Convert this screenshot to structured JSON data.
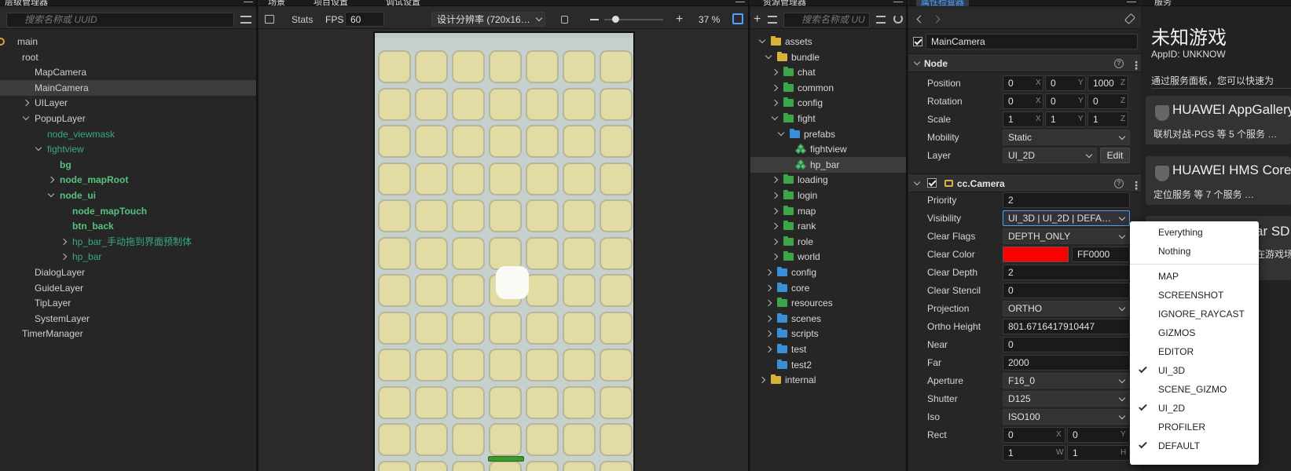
{
  "hierarchy": {
    "tab": "层级管理器",
    "search_placeholder": "搜索名称或 UUID",
    "nodes": [
      "main",
      "root",
      "MapCamera",
      "MainCamera",
      "UILayer",
      "PopupLayer",
      "node_viewmask",
      "fightview",
      "bg",
      "node_mapRoot",
      "node_ui",
      "node_mapTouch",
      "btn_back",
      "hp_bar_手动拖到界面预制体",
      "hp_bar",
      "DialogLayer",
      "GuideLayer",
      "TipLayer",
      "SystemLayer",
      "TimerManager"
    ]
  },
  "scene": {
    "tabs": [
      "场景",
      "项目设置",
      "调试设置"
    ],
    "stats_label": "Stats",
    "fps_label": "FPS",
    "fps_value": "60",
    "resolution": "设计分辨率 (720x16…",
    "zoom": "37 %"
  },
  "assets": {
    "tab": "资源管理器",
    "search_placeholder": "搜索名称或 UU",
    "items": [
      "assets",
      "bundle",
      "chat",
      "common",
      "config",
      "fight",
      "prefabs",
      "fightview",
      "hp_bar",
      "loading",
      "login",
      "map",
      "rank",
      "role",
      "world",
      "config",
      "core",
      "resources",
      "scenes",
      "scripts",
      "test",
      "test2",
      "internal"
    ]
  },
  "inspector": {
    "tab": "属性检查器",
    "node_name": "MainCamera",
    "node_section": "Node",
    "position_label": "Position",
    "position": [
      "0",
      "0",
      "1000"
    ],
    "rotation_label": "Rotation",
    "rotation": [
      "0",
      "0",
      "0"
    ],
    "scale_label": "Scale",
    "scale": [
      "1",
      "1",
      "1"
    ],
    "axes": [
      "X",
      "Y",
      "Z"
    ],
    "mobility_label": "Mobility",
    "mobility": "Static",
    "layer_label": "Layer",
    "layer": "UI_2D",
    "edit_label": "Edit",
    "camera_section": "cc.Camera",
    "priority_label": "Priority",
    "priority": "2",
    "visibility_label": "Visibility",
    "visibility": "UI_3D | UI_2D | DEFA…",
    "clear_flags_label": "Clear Flags",
    "clear_flags": "DEPTH_ONLY",
    "clear_color_label": "Clear Color",
    "clear_color_hex": "FF0000",
    "clear_color": "#ff0000",
    "clear_depth_label": "Clear Depth",
    "clear_depth": "2",
    "clear_stencil_label": "Clear Stencil",
    "clear_stencil": "0",
    "projection_label": "Projection",
    "projection": "ORTHO",
    "ortho_height_label": "Ortho Height",
    "ortho_height": "801.6716417910447",
    "near_label": "Near",
    "near": "0",
    "far_label": "Far",
    "far": "2000",
    "aperture_label": "Aperture",
    "aperture": "F16_0",
    "shutter_label": "Shutter",
    "shutter": "D125",
    "iso_label": "Iso",
    "iso": "ISO100",
    "rect_label": "Rect",
    "rect": [
      "0",
      "0",
      "1",
      "1"
    ],
    "rect_axes": [
      "X",
      "Y",
      "W",
      "H"
    ]
  },
  "services": {
    "tab": "服务",
    "game_name": "未知游戏",
    "app_id": "AppID: UNKNOW",
    "intro": "通过服务面板，您可以快速为",
    "cards": [
      {
        "title": "HUAWEI AppGallery",
        "desc": "联机对战-PGS 等 5 个服务 …"
      },
      {
        "title": "HUAWEI HMS Core",
        "desc": "定位服务 等 7 个服务 …"
      },
      {
        "title": "ar SD",
        "desc": "在游戏场"
      }
    ]
  },
  "visibility_menu": {
    "top": [
      "Everything",
      "Nothing"
    ],
    "layers": [
      {
        "label": "MAP",
        "checked": false
      },
      {
        "label": "SCREENSHOT",
        "checked": false
      },
      {
        "label": "IGNORE_RAYCAST",
        "checked": false
      },
      {
        "label": "GIZMOS",
        "checked": false
      },
      {
        "label": "EDITOR",
        "checked": false
      },
      {
        "label": "UI_3D",
        "checked": true
      },
      {
        "label": "SCENE_GIZMO",
        "checked": false
      },
      {
        "label": "UI_2D",
        "checked": true
      },
      {
        "label": "PROFILER",
        "checked": false
      },
      {
        "label": "DEFAULT",
        "checked": true
      }
    ]
  },
  "colors": {
    "accent": "#4fa3ff",
    "node_green": "#57c27e",
    "tile": "#e3dba4",
    "board": "#c6d0cc"
  }
}
